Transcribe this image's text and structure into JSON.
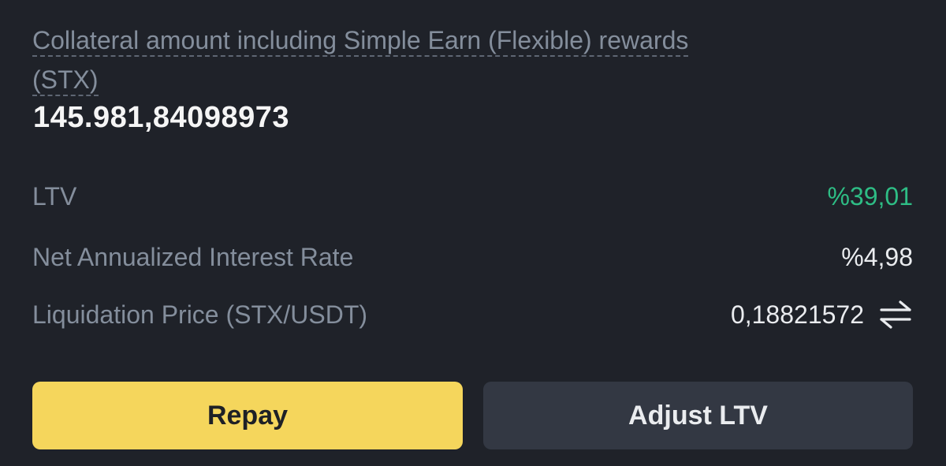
{
  "collateral": {
    "label": "Collateral amount including Simple Earn (Flexible) rewards (STX)",
    "value": "145.981,84098973"
  },
  "details": {
    "ltv": {
      "label": "LTV",
      "value": "%39,01",
      "color": "#2ebd85"
    },
    "interest_rate": {
      "label": "Net Annualized Interest Rate",
      "value": "%4,98"
    },
    "liquidation_price": {
      "label": "Liquidation Price (STX/USDT)",
      "value": "0,18821572",
      "icon": "swap-arrows-icon"
    }
  },
  "actions": {
    "repay_label": "Repay",
    "adjust_label": "Adjust LTV"
  },
  "colors": {
    "background": "#1f2229",
    "primary_button": "#f5d65c",
    "secondary_button": "#333843",
    "muted_text": "#848e9c",
    "positive": "#2ebd85"
  }
}
